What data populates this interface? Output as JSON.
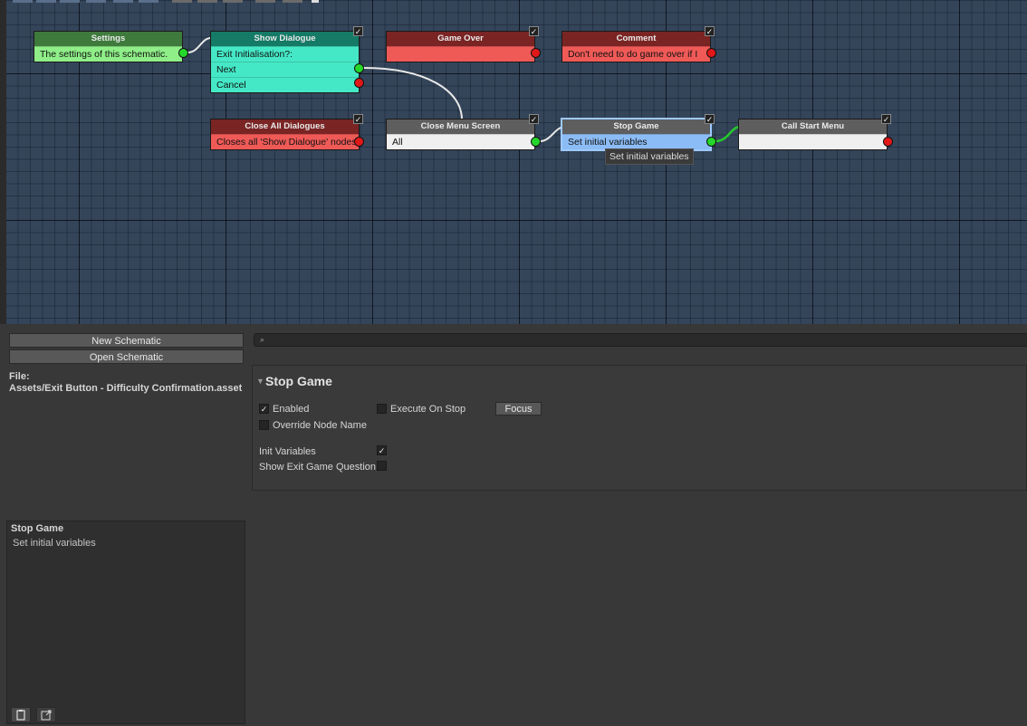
{
  "graph": {
    "nodes": {
      "settings": {
        "title": "Settings",
        "row1": "The settings of this schematic."
      },
      "show_dialogue": {
        "title": "Show Dialogue",
        "row1": "Exit Initialisation?:",
        "row2": "Next",
        "row3": "Cancel"
      },
      "game_over": {
        "title": "Game Over",
        "row1": ""
      },
      "comment": {
        "title": "Comment",
        "row1": "Don't need to do game over if I"
      },
      "close_all_dialogues": {
        "title": "Close All Dialogues",
        "row1": "Closes all 'Show Dialogue' nodes"
      },
      "close_menu_screen": {
        "title": "Close Menu Screen",
        "row1": "All"
      },
      "stop_game": {
        "title": "Stop Game",
        "row1": "Set initial variables"
      },
      "call_start_menu": {
        "title": "Call Start Menu",
        "row1": ""
      }
    },
    "checkmark": "✓",
    "tooltip": "Set initial variables"
  },
  "left_panel": {
    "new_button": "New Schematic",
    "open_button": "Open Schematic",
    "file_label": "File:",
    "file_path": "Assets/Exit Button - Difficulty Confirmation.asset",
    "info_title": "Stop Game",
    "info_text": "Set initial variables"
  },
  "inspector": {
    "search_placeholder": "",
    "section_title": "Stop Game",
    "enabled_label": "Enabled",
    "enabled_checked": true,
    "execute_on_stop_label": "Execute On Stop",
    "execute_on_stop_checked": false,
    "focus_button": "Focus",
    "override_node_name_label": "Override Node Name",
    "override_node_name_checked": false,
    "init_variables_label": "Init Variables",
    "init_variables_checked": true,
    "show_exit_game_question_label": "Show Exit Game Question",
    "show_exit_game_question_checked": false
  },
  "colors": {
    "graph_bg": "#34455a",
    "settings_header": "#3f7a3d",
    "settings_body": "#8fee88",
    "dialogue_header": "#157a66",
    "dialogue_body": "#45e8c6",
    "red_header": "#7a2424",
    "red_body": "#ef5a57",
    "grey_header": "#5e5e5e",
    "white_body": "#f0f0f0",
    "selected_body": "#8cbcf5",
    "selected_border": "#9ec9ff"
  }
}
